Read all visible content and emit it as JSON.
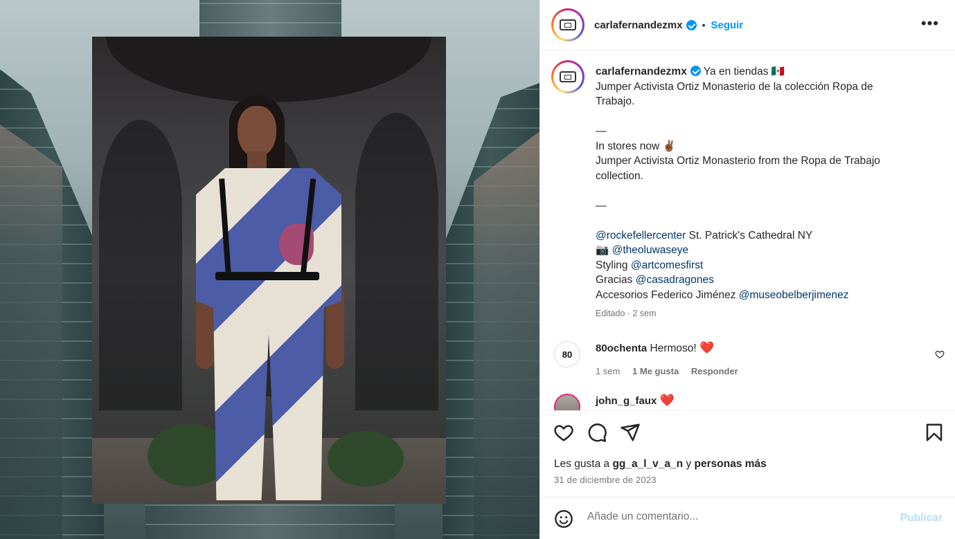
{
  "post": {
    "username": "carlafernandezmx",
    "dot": "•",
    "follow_label": "Seguir",
    "more_label": "•••"
  },
  "caption": {
    "username": "carlafernandezmx",
    "lines": [
      "Ya en tiendas 🇲🇽",
      "Jumper Activista Ortiz Monasterio de la colección Ropa de",
      "Trabajo.",
      "",
      "—",
      "In stores now ✌🏾",
      "Jumper Activista Ortiz Monasterio from the Ropa de Trabajo",
      "collection.",
      "",
      "—",
      ""
    ],
    "credit_1_mention": "@rockefellercenter",
    "credit_1_text": " St. Patrick's Cathedral NY",
    "credit_2_prefix": "📷 ",
    "credit_2_mention": "@theoluwaseye",
    "credit_3_prefix": "Styling ",
    "credit_3_mention": "@artcomesfirst",
    "credit_4_prefix": "Gracias ",
    "credit_4_mention": "@casadragones",
    "credit_5_prefix": "Accesorios Federico Jiménez ",
    "credit_5_mention": "@museobelberjimenez",
    "meta": "Editado · 2 sem"
  },
  "comments": [
    {
      "avatar_text": "80",
      "username": "80ochenta",
      "text": "Hermoso!",
      "emoji": "❤️",
      "time": "1 sem",
      "likes": "1 Me gusta",
      "reply": "Responder"
    },
    {
      "username": "john_g_faux",
      "emoji": "❤️"
    }
  ],
  "actions": {
    "likes_prefix": "Les gusta a ",
    "likes_user": "gg_a_l_v_a_n",
    "likes_middle": " y ",
    "likes_others": "personas más",
    "date": "31 de diciembre de 2023"
  },
  "comment_bar": {
    "placeholder": "Añade un comentario...",
    "post_label": "Publicar"
  },
  "colors": {
    "accent": "#0095f6",
    "mention": "#00376b",
    "muted": "#737373",
    "heart": "#ed1c24",
    "post_disabled": "#b2dffc"
  },
  "icons": [
    "heart-icon",
    "comment-icon",
    "share-icon",
    "bookmark-icon",
    "emoji-icon",
    "verified-icon",
    "more-icon"
  ]
}
